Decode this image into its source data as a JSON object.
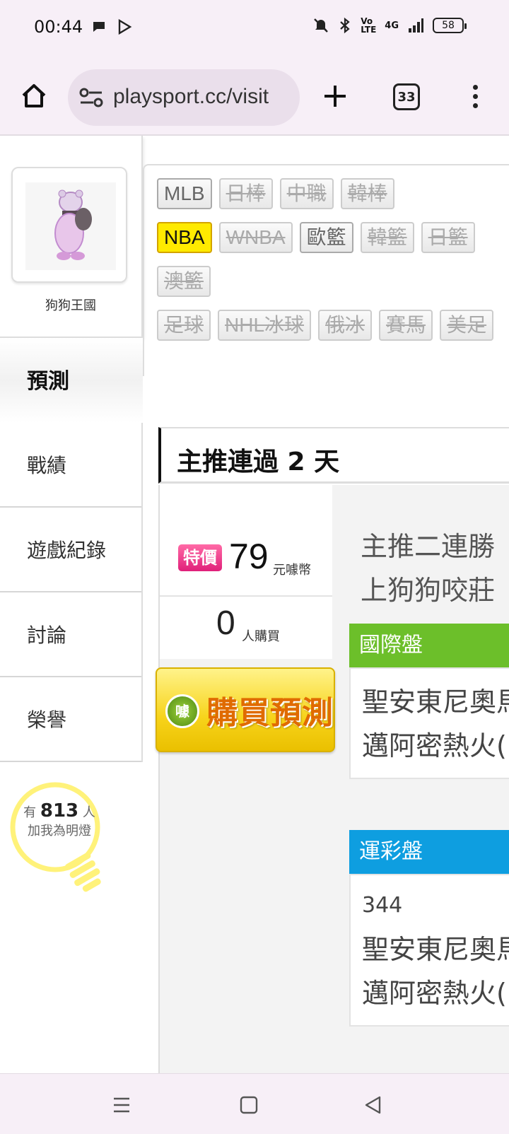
{
  "status": {
    "time": "00:44",
    "battery": "58",
    "network": "4G"
  },
  "browser": {
    "url": "playsport.cc/visit",
    "tab_count": "33"
  },
  "profile": {
    "name": "狗狗王國"
  },
  "nav": {
    "active": "預測",
    "items": [
      "戰績",
      "遊戲紀錄",
      "討論",
      "榮譽"
    ]
  },
  "fans": {
    "prefix": "有",
    "count": "813",
    "suffix": "人",
    "caption": "加我為明燈"
  },
  "leagues": {
    "row1": [
      "MLB",
      "日棒",
      "中職",
      "韓棒"
    ],
    "row2": [
      "NBA",
      "WNBA",
      "歐籃",
      "韓籃",
      "日籃"
    ],
    "row3": [
      "澳籃"
    ],
    "row4": [
      "足球",
      "NHL冰球",
      "俄冰",
      "賽馬",
      "美足"
    ],
    "active": "NBA"
  },
  "heading": "主推連過 2 天",
  "offer": {
    "badge": "特價",
    "price": "79",
    "price_unit": "元噱幣",
    "buyers": "0",
    "buyers_unit": "人購買",
    "buy_button": "購買預測",
    "coin_label": "噱"
  },
  "description": {
    "line1": "主推二連勝",
    "line2": "上狗狗咬莊"
  },
  "sections": {
    "international": {
      "title": "國際盤",
      "line1": "聖安東尼奧馬",
      "line2": "邁阿密熱火("
    },
    "sportslottery": {
      "title": "運彩盤",
      "code": "344",
      "line1": "聖安東尼奧馬",
      "line2": "邁阿密熱火("
    }
  },
  "colors": {
    "international_header": "#6cbf2a",
    "sportslottery_header": "#0e9ee0",
    "active_chip": "#ffea00",
    "badge": "#e0207a"
  }
}
